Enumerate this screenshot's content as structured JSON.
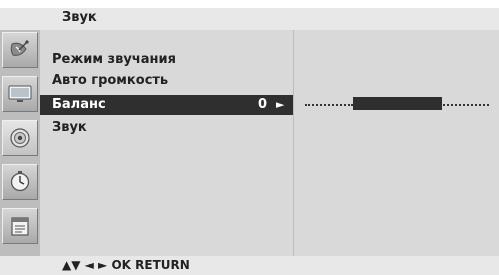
{
  "title": "Звук",
  "sidebar": {
    "items": [
      {
        "icon": "satellite-dish-icon",
        "active": false
      },
      {
        "icon": "tv-picture-icon",
        "active": false
      },
      {
        "icon": "speaker-sound-icon",
        "active": true
      },
      {
        "icon": "clock-time-icon",
        "active": false
      },
      {
        "icon": "options-calendar-icon",
        "active": false
      }
    ]
  },
  "menu": {
    "items": [
      {
        "label": "Режим звучания"
      },
      {
        "label": "Авто громкость"
      },
      {
        "label": "Баланс",
        "value": "0",
        "arrow": "►",
        "selected": true
      },
      {
        "label": "Звук"
      }
    ]
  },
  "balance": {
    "value": 0
  },
  "footer": {
    "text": "▲▼  ◄ ►  OK  RETURN"
  },
  "colors": {
    "highlight": "#2f2f2f",
    "panel": "#d9d9d9",
    "title_bar": "#e8e8e8"
  }
}
